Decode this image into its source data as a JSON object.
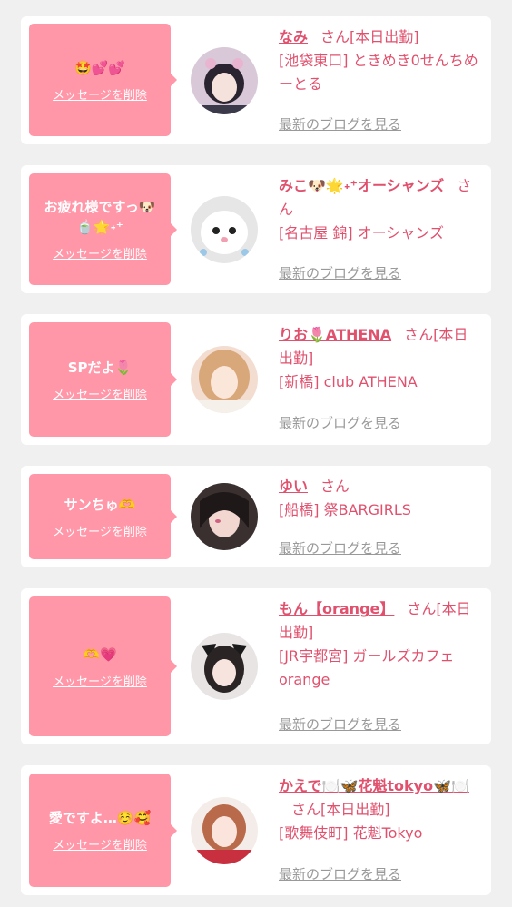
{
  "cards": [
    {
      "message": "🤩💕💕",
      "delete_label": "メッセージを削除",
      "name": "なみ",
      "suffix": "さん[本日出勤]",
      "shop": "[池袋東口] ときめき0せんちめーとる",
      "blog_label": "最新のブログを見る"
    },
    {
      "message": "お疲れ様ですっ🐶🍵🌟˖⁺",
      "delete_label": "メッセージを削除",
      "name": "みこ🐶🌟˖⁺オーシャンズ",
      "suffix": "さん",
      "shop": "[名古屋 錦] オーシャンズ",
      "blog_label": "最新のブログを見る"
    },
    {
      "message": "SPだよ🌷",
      "delete_label": "メッセージを削除",
      "name": "りお🌷ATHENA",
      "suffix": "さん[本日出勤]",
      "shop": "[新橋] club ATHENA",
      "blog_label": "最新のブログを見る"
    },
    {
      "message": "サンちゅ🫶",
      "delete_label": "メッセージを削除",
      "name": "ゆい",
      "suffix": "さん",
      "shop": "[船橋] 祭BARGIRLS",
      "blog_label": "最新のブログを見る"
    },
    {
      "message": "🫶💗",
      "delete_label": "メッセージを削除",
      "name": "もん【orange】",
      "suffix": "さん[本日出勤]",
      "shop": "[JR宇都宮] ガールズカフェ orange",
      "blog_label": "最新のブログを見る"
    },
    {
      "message": "愛ですよ…☺️🥰",
      "delete_label": "メッセージを削除",
      "name": "かえで🍽️🦋花魁tokyo🦋🍽️",
      "suffix": "さん[本日出勤]",
      "shop": "[歌舞伎町] 花魁Tokyo",
      "blog_label": "最新のブログを見る"
    }
  ],
  "colors": {
    "background": "#f0f0f0",
    "card": "#ffffff",
    "bubble": "#ff97a8",
    "accent_text": "#e0516e",
    "link_gray": "#999999"
  }
}
